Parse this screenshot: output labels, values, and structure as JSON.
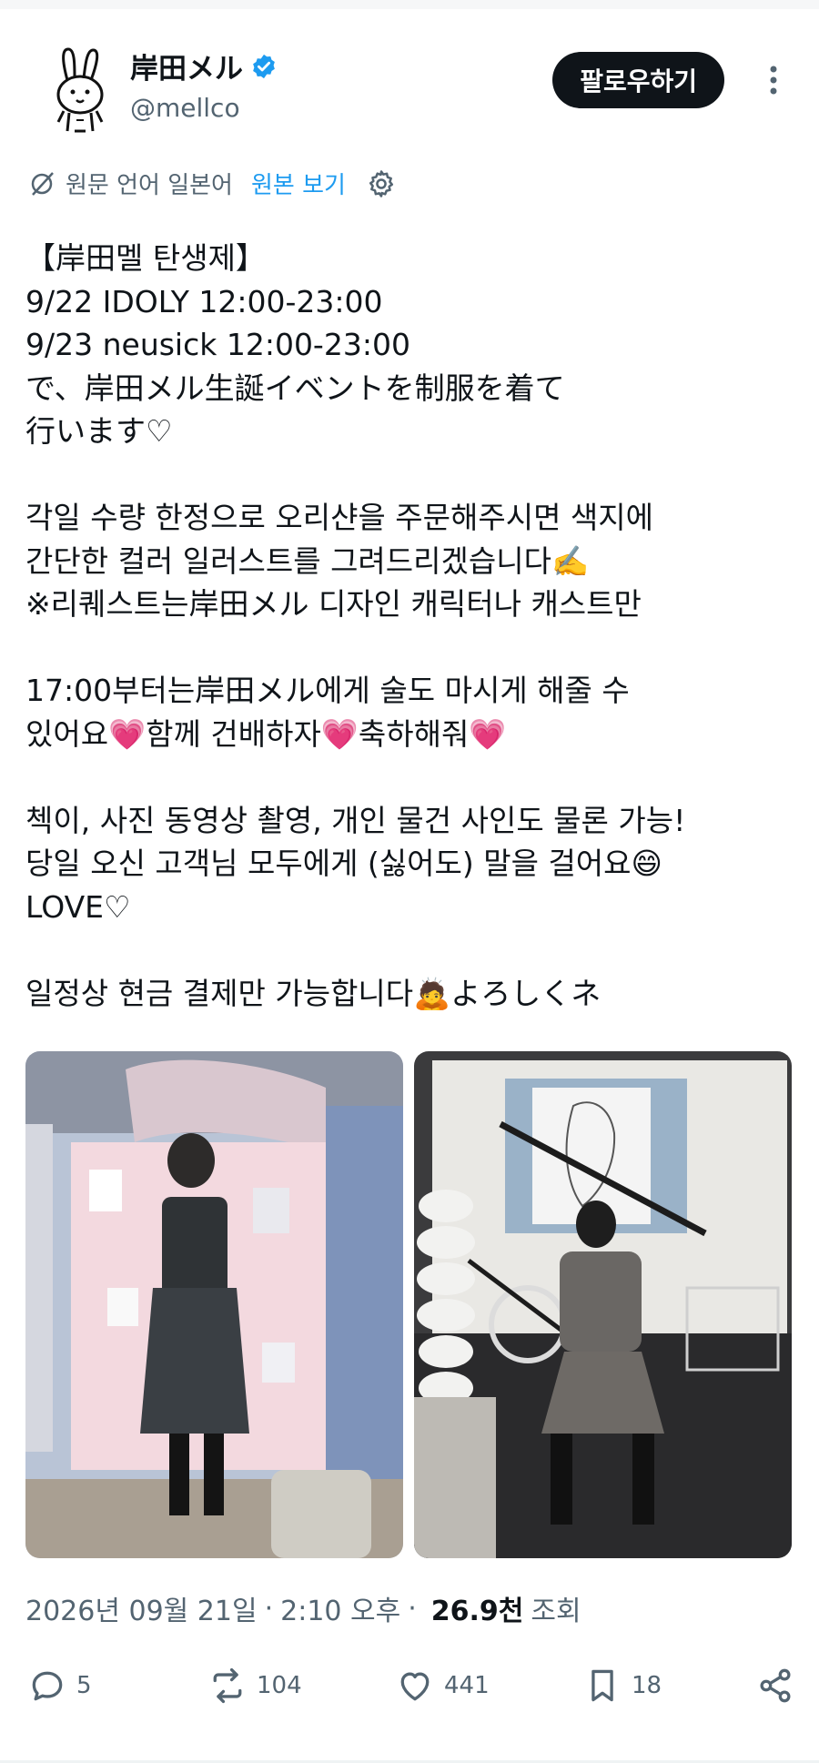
{
  "author": {
    "display_name": "岸田メル",
    "handle": "@mellco",
    "verified": true
  },
  "follow_button": "팔로우하기",
  "translation": {
    "notice": "원문 언어 일본어",
    "show_original": "원본 보기"
  },
  "tweet_lines": [
    "【岸田멜 탄생제】",
    "9/22 IDOLY 12:00-23:00",
    "9/23 neusick 12:00-23:00",
    "で、岸田メル生誕イベントを制服を着て",
    "行います♡",
    "",
    "각일 수량 한정으로 오리샨을 주문해주시면 색지에",
    "간단한 컬러 일러스트를 그려드리겠습니다✍️",
    "※리퀘스트는岸田メル 디자인 캐릭터나 캐스트만",
    "",
    "17:00부터는岸田メル에게 술도 마시게 해줄 수",
    "있어요💗함께 건배하자💗축하해줘💗",
    "",
    "첵이, 사진 동영상 촬영, 개인 물건 사인도 물론 가능!",
    "당일 오신 고객님 모두에게 (싫어도) 말을 걸어요😄",
    "LOVE♡",
    "",
    "일정상 현금 결제만 가능합니다🙇よろしくネ"
  ],
  "meta": {
    "date": "2026년 09월 21일",
    "time": "2:10 오후",
    "views_count": "26.9천",
    "views_label": "조회"
  },
  "actions": {
    "replies": "5",
    "retweets": "104",
    "likes": "441",
    "bookmarks": "18"
  },
  "colors": {
    "accent": "#1d9bf0",
    "text": "#0f1419",
    "muted": "#536471",
    "button_bg": "#0f1419"
  }
}
